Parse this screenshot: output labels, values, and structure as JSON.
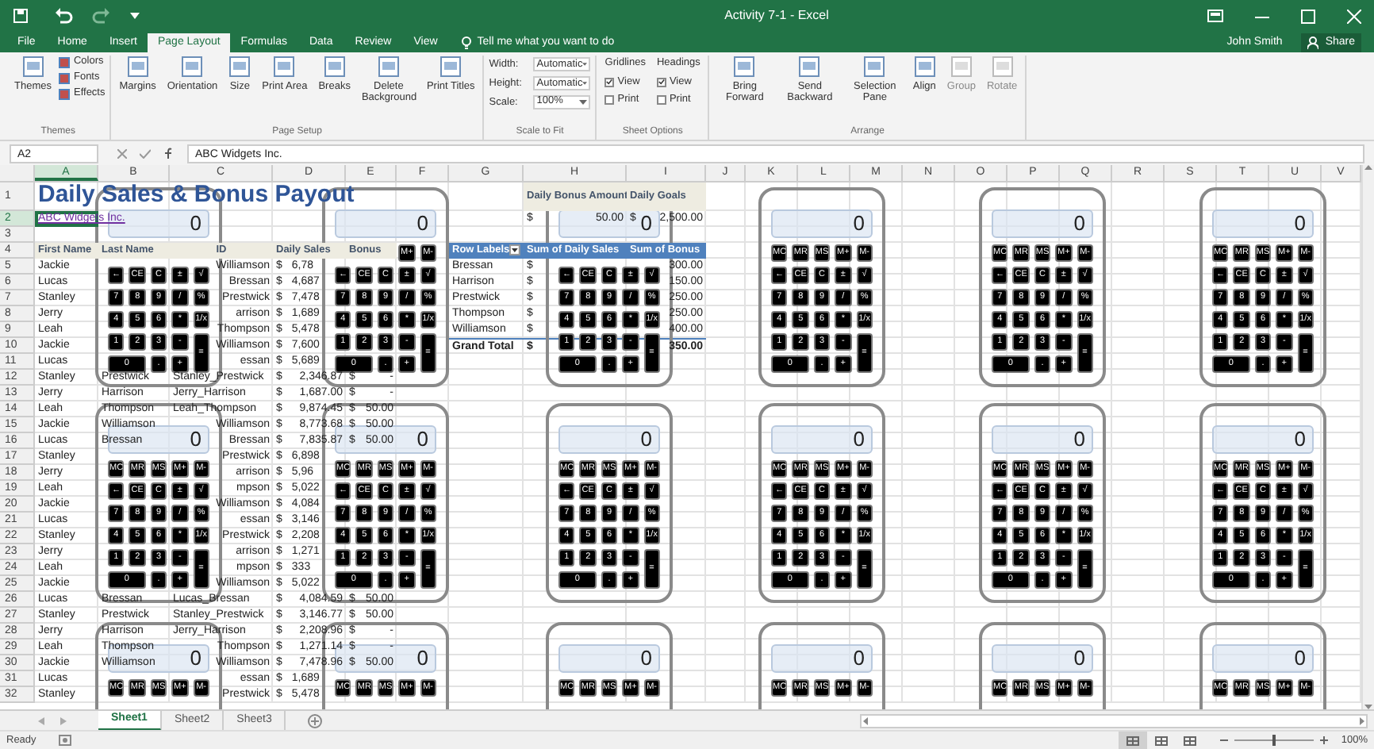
{
  "window": {
    "title": "Activity 7-1 - Excel",
    "user": "John Smith",
    "share": "Share"
  },
  "ribbon_tabs": [
    {
      "label": "File",
      "selected": false
    },
    {
      "label": "Home",
      "selected": false
    },
    {
      "label": "Insert",
      "selected": false
    },
    {
      "label": "Page Layout",
      "selected": true
    },
    {
      "label": "Formulas",
      "selected": false
    },
    {
      "label": "Data",
      "selected": false
    },
    {
      "label": "Review",
      "selected": false
    },
    {
      "label": "View",
      "selected": false
    }
  ],
  "tell_me": "Tell me what you want to do",
  "ribbon_groups": [
    {
      "kind": "themes",
      "label": "Themes",
      "large": [
        {
          "label": "Themes",
          "disabled": false
        }
      ],
      "small": [
        "Colors",
        "Fonts",
        "Effects"
      ]
    },
    {
      "kind": "buttons",
      "label": "Page Setup",
      "large": [
        {
          "label": "Margins",
          "disabled": false
        },
        {
          "label": "Orientation",
          "disabled": false
        },
        {
          "label": "Size",
          "disabled": false
        },
        {
          "label": "Print Area",
          "disabled": false
        },
        {
          "label": "Breaks",
          "disabled": false
        },
        {
          "label": "Delete Background",
          "disabled": false
        },
        {
          "label": "Print Titles",
          "disabled": false
        }
      ]
    },
    {
      "kind": "scale",
      "label": "Scale to Fit",
      "fields": [
        {
          "label": "Width:",
          "value": "Automatic"
        },
        {
          "label": "Height:",
          "value": "Automatic"
        },
        {
          "label": "Scale:",
          "value": "100%"
        }
      ]
    },
    {
      "kind": "options",
      "label": "Sheet Options",
      "columns": [
        {
          "label": "Gridlines",
          "options": [
            {
              "label": "View",
              "checked": true
            },
            {
              "label": "Print",
              "checked": false
            }
          ]
        },
        {
          "label": "Headings",
          "options": [
            {
              "label": "View",
              "checked": true
            },
            {
              "label": "Print",
              "checked": false
            }
          ]
        }
      ]
    },
    {
      "kind": "buttons",
      "label": "Arrange",
      "large": [
        {
          "label": "Bring Forward",
          "disabled": false
        },
        {
          "label": "Send Backward",
          "disabled": false
        },
        {
          "label": "Selection Pane",
          "disabled": false
        },
        {
          "label": "Align",
          "disabled": false
        },
        {
          "label": "Group",
          "disabled": true
        },
        {
          "label": "Rotate",
          "disabled": true
        }
      ]
    }
  ],
  "formula_bar": {
    "name_box": "A2",
    "formula": "ABC Widgets Inc."
  },
  "sheet": {
    "columns": [
      "A",
      "B",
      "C",
      "D",
      "E",
      "F",
      "G",
      "H",
      "I",
      "J",
      "K",
      "L",
      "M",
      "N",
      "O",
      "P",
      "Q",
      "R",
      "S",
      "T",
      "U",
      "V"
    ],
    "rows": [
      {
        "n": "1",
        "cells": {
          "A": {
            "text": "Daily Sales & Bonus Payout",
            "kind": "title"
          },
          "H": {
            "text": "Daily Bonus Amount",
            "kind": "header"
          },
          "I": {
            "text": "Daily Goals",
            "kind": "header"
          }
        }
      },
      {
        "n": "2",
        "cells": {
          "A": {
            "text": "ABC Widgets Inc.",
            "kind": "link"
          },
          "H": {
            "prefix": "$",
            "text": "50.00",
            "kind": "money"
          },
          "I": {
            "prefix": "$",
            "text": "2,500.00",
            "kind": "money"
          }
        }
      },
      {
        "n": "3",
        "cells": {}
      },
      {
        "n": "4",
        "cells": {
          "A": {
            "text": "First Name",
            "kind": "header"
          },
          "B": {
            "text": "Last Name",
            "kind": "header"
          },
          "C": {
            "text": "ID",
            "kind": "header"
          },
          "D": {
            "text": "Daily Sales",
            "kind": "header"
          },
          "E": {
            "text": "Bonus",
            "kind": "header"
          },
          "G": {
            "text": "Row Labels",
            "kind": "pivot_header"
          },
          "H": {
            "text": "Sum of Daily Sales",
            "kind": "pivot_header"
          },
          "I": {
            "text": "Sum of Bonus",
            "kind": "pivot_header"
          }
        }
      },
      {
        "n": "5",
        "cells": {
          "A": {
            "text": "Jackie"
          },
          "C": {
            "text": "Williamson",
            "kind": "right"
          },
          "D": {
            "prefix": "$",
            "text": "6,78",
            "kind": "cut"
          },
          "G": {
            "text": "Bressan"
          },
          "H": {
            "prefix": "$",
            "kind": "cut"
          },
          "I": {
            "text": "300.00",
            "kind": "money"
          }
        }
      },
      {
        "n": "6",
        "cells": {
          "A": {
            "text": "Lucas"
          },
          "C": {
            "text": "Bressan",
            "kind": "right"
          },
          "D": {
            "prefix": "$",
            "text": "4,687",
            "kind": "cut"
          },
          "G": {
            "text": "Harrison"
          },
          "H": {
            "prefix": "$",
            "kind": "cut"
          },
          "I": {
            "text": "150.00",
            "kind": "money"
          }
        }
      },
      {
        "n": "7",
        "cells": {
          "A": {
            "text": "Stanley"
          },
          "C": {
            "text": "Prestwick",
            "kind": "right"
          },
          "D": {
            "prefix": "$",
            "text": "7,478",
            "kind": "cut"
          },
          "G": {
            "text": "Prestwick"
          },
          "H": {
            "prefix": "$",
            "kind": "cut"
          },
          "I": {
            "text": "250.00",
            "kind": "money"
          }
        }
      },
      {
        "n": "8",
        "cells": {
          "A": {
            "text": "Jerry"
          },
          "C": {
            "text": "arrison",
            "kind": "right"
          },
          "D": {
            "prefix": "$",
            "text": "1,689",
            "kind": "cut"
          },
          "G": {
            "text": "Thompson"
          },
          "H": {
            "prefix": "$",
            "kind": "cut"
          },
          "I": {
            "text": "250.00",
            "kind": "money"
          }
        }
      },
      {
        "n": "9",
        "cells": {
          "A": {
            "text": "Leah"
          },
          "C": {
            "text": "Thompson",
            "kind": "right"
          },
          "D": {
            "prefix": "$",
            "text": "5,478",
            "kind": "cut"
          },
          "G": {
            "text": "Williamson"
          },
          "H": {
            "prefix": "$",
            "kind": "cut"
          },
          "I": {
            "text": "400.00",
            "kind": "money"
          }
        }
      },
      {
        "n": "10",
        "cells": {
          "A": {
            "text": "Jackie"
          },
          "C": {
            "text": "Williamson",
            "kind": "right"
          },
          "D": {
            "prefix": "$",
            "text": "7,600",
            "kind": "cut"
          },
          "G": {
            "text": "Grand Total",
            "kind": "total"
          },
          "H": {
            "prefix": "$",
            "kind": "total"
          },
          "I": {
            "text": "350.00",
            "kind": "total_money"
          }
        }
      },
      {
        "n": "11",
        "cells": {
          "A": {
            "text": "Lucas"
          },
          "C": {
            "text": "essan",
            "kind": "right"
          },
          "D": {
            "prefix": "$",
            "text": "5,689",
            "kind": "cut"
          }
        }
      },
      {
        "n": "12",
        "cells": {
          "A": {
            "text": "Stanley"
          },
          "B": {
            "text": "Prestwick"
          },
          "C": {
            "text": "Stanley_Prestwick"
          },
          "D": {
            "prefix": "$",
            "text": "2,346.87",
            "kind": "money"
          },
          "E": {
            "prefix": "$",
            "text": "-",
            "kind": "money"
          }
        }
      },
      {
        "n": "13",
        "cells": {
          "A": {
            "text": "Jerry"
          },
          "B": {
            "text": "Harrison"
          },
          "C": {
            "text": "Jerry_Harrison"
          },
          "D": {
            "prefix": "$",
            "text": "1,687.00",
            "kind": "money"
          },
          "E": {
            "prefix": "$",
            "text": "-",
            "kind": "money"
          }
        }
      },
      {
        "n": "14",
        "cells": {
          "A": {
            "text": "Leah"
          },
          "B": {
            "text": "Thompson"
          },
          "C": {
            "text": "Leah_Thompson"
          },
          "D": {
            "prefix": "$",
            "text": "9,874.45",
            "kind": "money"
          },
          "E": {
            "prefix": "$",
            "text": "50.00",
            "kind": "money"
          }
        }
      },
      {
        "n": "15",
        "cells": {
          "A": {
            "text": "Jackie"
          },
          "B": {
            "text": "Williamson"
          },
          "C": {
            "text": "Williamson",
            "kind": "right"
          },
          "D": {
            "prefix": "$",
            "text": "8,773.68",
            "kind": "money"
          },
          "E": {
            "prefix": "$",
            "text": "50.00",
            "kind": "money"
          }
        }
      },
      {
        "n": "16",
        "cells": {
          "A": {
            "text": "Lucas"
          },
          "B": {
            "text": "Bressan"
          },
          "C": {
            "text": "Bressan",
            "kind": "right"
          },
          "D": {
            "prefix": "$",
            "text": "7,835.87",
            "kind": "money"
          },
          "E": {
            "prefix": "$",
            "text": "50.00",
            "kind": "money"
          }
        }
      },
      {
        "n": "17",
        "cells": {
          "A": {
            "text": "Stanley"
          },
          "C": {
            "text": "Prestwick",
            "kind": "right"
          },
          "D": {
            "prefix": "$",
            "text": "6,898",
            "kind": "cut"
          }
        }
      },
      {
        "n": "18",
        "cells": {
          "A": {
            "text": "Jerry"
          },
          "C": {
            "text": "arrison",
            "kind": "right"
          },
          "D": {
            "prefix": "$",
            "text": "5,96",
            "kind": "cut"
          }
        }
      },
      {
        "n": "19",
        "cells": {
          "A": {
            "text": "Leah"
          },
          "C": {
            "text": "mpson",
            "kind": "right"
          },
          "D": {
            "prefix": "$",
            "text": "5,022",
            "kind": "cut"
          }
        }
      },
      {
        "n": "20",
        "cells": {
          "A": {
            "text": "Jackie"
          },
          "C": {
            "text": "Williamson",
            "kind": "right"
          },
          "D": {
            "prefix": "$",
            "text": "4,084",
            "kind": "cut"
          }
        }
      },
      {
        "n": "21",
        "cells": {
          "A": {
            "text": "Lucas"
          },
          "C": {
            "text": "essan",
            "kind": "right"
          },
          "D": {
            "prefix": "$",
            "text": "3,146",
            "kind": "cut"
          }
        }
      },
      {
        "n": "22",
        "cells": {
          "A": {
            "text": "Stanley"
          },
          "C": {
            "text": "Prestwick",
            "kind": "right"
          },
          "D": {
            "prefix": "$",
            "text": "2,208",
            "kind": "cut"
          }
        }
      },
      {
        "n": "23",
        "cells": {
          "A": {
            "text": "Jerry"
          },
          "C": {
            "text": "arrison",
            "kind": "right"
          },
          "D": {
            "prefix": "$",
            "text": "1,271",
            "kind": "cut"
          }
        }
      },
      {
        "n": "24",
        "cells": {
          "A": {
            "text": "Leah"
          },
          "C": {
            "text": "mpson",
            "kind": "right"
          },
          "D": {
            "prefix": "$",
            "text": "333",
            "kind": "cut"
          }
        }
      },
      {
        "n": "25",
        "cells": {
          "A": {
            "text": "Jackie"
          },
          "C": {
            "text": "Williamson",
            "kind": "right"
          },
          "D": {
            "prefix": "$",
            "text": "5,022",
            "kind": "cut"
          }
        }
      },
      {
        "n": "26",
        "cells": {
          "A": {
            "text": "Lucas"
          },
          "B": {
            "text": "Bressan"
          },
          "C": {
            "text": "Lucas_Bressan"
          },
          "D": {
            "prefix": "$",
            "text": "4,084.59",
            "kind": "money"
          },
          "E": {
            "prefix": "$",
            "text": "50.00",
            "kind": "money"
          }
        }
      },
      {
        "n": "27",
        "cells": {
          "A": {
            "text": "Stanley"
          },
          "B": {
            "text": "Prestwick"
          },
          "C": {
            "text": "Stanley_Prestwick"
          },
          "D": {
            "prefix": "$",
            "text": "3,146.77",
            "kind": "money"
          },
          "E": {
            "prefix": "$",
            "text": "50.00",
            "kind": "money"
          }
        }
      },
      {
        "n": "28",
        "cells": {
          "A": {
            "text": "Jerry"
          },
          "B": {
            "text": "Harrison"
          },
          "C": {
            "text": "Jerry_Harrison"
          },
          "D": {
            "prefix": "$",
            "text": "2,208.96",
            "kind": "money"
          },
          "E": {
            "prefix": "$",
            "text": "-",
            "kind": "money"
          }
        }
      },
      {
        "n": "29",
        "cells": {
          "A": {
            "text": "Leah"
          },
          "B": {
            "text": "Thompson"
          },
          "C": {
            "text": "Thompson",
            "kind": "right"
          },
          "D": {
            "prefix": "$",
            "text": "1,271.14",
            "kind": "money"
          },
          "E": {
            "prefix": "$",
            "text": "-",
            "kind": "money"
          }
        }
      },
      {
        "n": "30",
        "cells": {
          "A": {
            "text": "Jackie"
          },
          "B": {
            "text": "Williamson"
          },
          "C": {
            "text": "Williamson",
            "kind": "right"
          },
          "D": {
            "prefix": "$",
            "text": "7,478.96",
            "kind": "money"
          },
          "E": {
            "prefix": "$",
            "text": "50.00",
            "kind": "money"
          }
        }
      },
      {
        "n": "31",
        "cells": {
          "A": {
            "text": "Lucas"
          },
          "C": {
            "text": "essan",
            "kind": "right"
          },
          "D": {
            "prefix": "$",
            "text": "1,689",
            "kind": "cut"
          }
        }
      },
      {
        "n": "32",
        "cells": {
          "A": {
            "text": "Stanley"
          },
          "C": {
            "text": "Prestwick",
            "kind": "right"
          },
          "D": {
            "prefix": "$",
            "text": "5,478",
            "kind": "cut"
          }
        }
      }
    ]
  },
  "calculators": [
    {
      "kind": "covered_top",
      "display": "0",
      "key_rows": [
        [
          "←",
          "CE",
          "C",
          "±",
          "√"
        ],
        [
          "7",
          "8",
          "9",
          "/",
          "%"
        ],
        [
          "4",
          "5",
          "6",
          "*",
          "1/x"
        ],
        [
          "1",
          "2",
          "3",
          "-",
          "="
        ],
        [
          "0",
          ".",
          "+"
        ]
      ]
    },
    {
      "kind": "covered_top",
      "display": "0",
      "key_rows": [
        [
          "M+",
          "M-"
        ],
        [
          "←",
          "CE",
          "C",
          "±",
          "√"
        ],
        [
          "7",
          "8",
          "9",
          "/",
          "%"
        ],
        [
          "4",
          "5",
          "6",
          "*",
          "1/x"
        ],
        [
          "1",
          "2",
          "3",
          "-",
          "="
        ],
        [
          "0",
          ".",
          "+"
        ]
      ]
    },
    {
      "kind": "covered_top",
      "display": "0",
      "key_rows": [
        [
          "←",
          "CE",
          "C",
          "±",
          "√"
        ],
        [
          "7",
          "8",
          "9",
          "/",
          "%"
        ],
        [
          "4",
          "5",
          "6",
          "*",
          "1/x"
        ],
        [
          "1",
          "2",
          "3",
          "-",
          "="
        ],
        [
          "0",
          ".",
          "+"
        ]
      ]
    },
    {
      "kind": "full",
      "display": "0",
      "key_rows": [
        [
          "MC",
          "MR",
          "MS",
          "M+",
          "M-"
        ],
        [
          "←",
          "CE",
          "C",
          "±",
          "√"
        ],
        [
          "7",
          "8",
          "9",
          "/",
          "%"
        ],
        [
          "4",
          "5",
          "6",
          "*",
          "1/x"
        ],
        [
          "1",
          "2",
          "3",
          "-",
          "="
        ],
        [
          "0",
          ".",
          "+"
        ]
      ]
    },
    {
      "kind": "full",
      "display": "0",
      "key_rows": [
        [
          "MC",
          "MR",
          "MS",
          "M+",
          "M-"
        ],
        [
          "←",
          "CE",
          "C",
          "±",
          "√"
        ],
        [
          "7",
          "8",
          "9",
          "/",
          "%"
        ],
        [
          "4",
          "5",
          "6",
          "*",
          "1/x"
        ],
        [
          "1",
          "2",
          "3",
          "-",
          "="
        ],
        [
          "0",
          ".",
          "+"
        ]
      ]
    },
    {
      "kind": "full",
      "display": "0",
      "key_rows": [
        [
          "MC",
          "MR",
          "MS",
          "M+",
          "M-"
        ],
        [
          "←",
          "CE",
          "C",
          "±",
          "√"
        ],
        [
          "7",
          "8",
          "9",
          "/",
          "%"
        ],
        [
          "4",
          "5",
          "6",
          "*",
          "1/x"
        ],
        [
          "1",
          "2",
          "3",
          "-",
          "="
        ],
        [
          "0",
          ".",
          "+"
        ]
      ]
    },
    {
      "kind": "full",
      "display": "0",
      "key_rows": [
        [
          "MC",
          "MR",
          "MS",
          "M+",
          "M-"
        ],
        [
          "←",
          "CE",
          "C",
          "±",
          "√"
        ],
        [
          "7",
          "8",
          "9",
          "/",
          "%"
        ],
        [
          "4",
          "5",
          "6",
          "*",
          "1/x"
        ],
        [
          "1",
          "2",
          "3",
          "-",
          "="
        ],
        [
          "0",
          ".",
          "+"
        ]
      ]
    },
    {
      "kind": "full",
      "display": "0",
      "key_rows": [
        [
          "MC",
          "MR",
          "MS",
          "M+",
          "M-"
        ],
        [
          "←",
          "CE",
          "C",
          "±",
          "√"
        ],
        [
          "7",
          "8",
          "9",
          "/",
          "%"
        ],
        [
          "4",
          "5",
          "6",
          "*",
          "1/x"
        ],
        [
          "1",
          "2",
          "3",
          "-",
          "="
        ],
        [
          "0",
          ".",
          "+"
        ]
      ]
    },
    {
      "kind": "full",
      "display": "0",
      "key_rows": [
        [
          "MC",
          "MR",
          "MS",
          "M+",
          "M-"
        ],
        [
          "←",
          "CE",
          "C",
          "±",
          "√"
        ],
        [
          "7",
          "8",
          "9",
          "/",
          "%"
        ],
        [
          "4",
          "5",
          "6",
          "*",
          "1/x"
        ],
        [
          "1",
          "2",
          "3",
          "-",
          "="
        ],
        [
          "0",
          ".",
          "+"
        ]
      ]
    },
    {
      "kind": "full",
      "display": "0",
      "key_rows": [
        [
          "MC",
          "MR",
          "MS",
          "M+",
          "M-"
        ],
        [
          "←",
          "CE",
          "C",
          "±",
          "√"
        ],
        [
          "7",
          "8",
          "9",
          "/",
          "%"
        ],
        [
          "4",
          "5",
          "6",
          "*",
          "1/x"
        ],
        [
          "1",
          "2",
          "3",
          "-",
          "="
        ],
        [
          "0",
          ".",
          "+"
        ]
      ]
    },
    {
      "kind": "full",
      "display": "0",
      "key_rows": [
        [
          "MC",
          "MR",
          "MS",
          "M+",
          "M-"
        ],
        [
          "←",
          "CE",
          "C",
          "±",
          "√"
        ],
        [
          "7",
          "8",
          "9",
          "/",
          "%"
        ],
        [
          "4",
          "5",
          "6",
          "*",
          "1/x"
        ],
        [
          "1",
          "2",
          "3",
          "-",
          "="
        ],
        [
          "0",
          ".",
          "+"
        ]
      ]
    },
    {
      "kind": "full",
      "display": "0",
      "key_rows": [
        [
          "MC",
          "MR",
          "MS",
          "M+",
          "M-"
        ],
        [
          "←",
          "CE",
          "C",
          "±",
          "√"
        ],
        [
          "7",
          "8",
          "9",
          "/",
          "%"
        ],
        [
          "4",
          "5",
          "6",
          "*",
          "1/x"
        ],
        [
          "1",
          "2",
          "3",
          "-",
          "="
        ],
        [
          "0",
          ".",
          "+"
        ]
      ]
    },
    {
      "kind": "cut_bottom",
      "display": "0",
      "key_rows": [
        [
          "MC",
          "MR",
          "MS",
          "M+",
          "M-"
        ]
      ]
    },
    {
      "kind": "cut_bottom",
      "display": "0",
      "key_rows": [
        [
          "MC",
          "MR",
          "MS",
          "M+",
          "M-"
        ]
      ]
    },
    {
      "kind": "cut_bottom",
      "display": "0",
      "key_rows": [
        [
          "MC",
          "MR",
          "MS",
          "M+",
          "M-"
        ]
      ]
    },
    {
      "kind": "cut_bottom",
      "display": "0",
      "key_rows": [
        [
          "MC",
          "MR",
          "MS",
          "M+",
          "M-"
        ]
      ]
    },
    {
      "kind": "cut_bottom",
      "display": "0",
      "key_rows": [
        [
          "MC",
          "MR",
          "MS",
          "M+",
          "M-"
        ]
      ]
    },
    {
      "kind": "cut_bottom",
      "display": "0",
      "key_rows": [
        [
          "MC",
          "MR",
          "MS",
          "M+",
          "M-"
        ]
      ]
    }
  ],
  "sheet_tabs": [
    {
      "label": "Sheet1",
      "selected": true
    },
    {
      "label": "Sheet2",
      "selected": false
    },
    {
      "label": "Sheet3",
      "selected": false
    }
  ],
  "status_bar": {
    "status": "Ready",
    "zoom": "100%",
    "zoom_slider": {
      "level": 0.5
    },
    "views": [
      {
        "selected": true
      },
      {
        "selected": false
      },
      {
        "selected": false
      }
    ]
  }
}
